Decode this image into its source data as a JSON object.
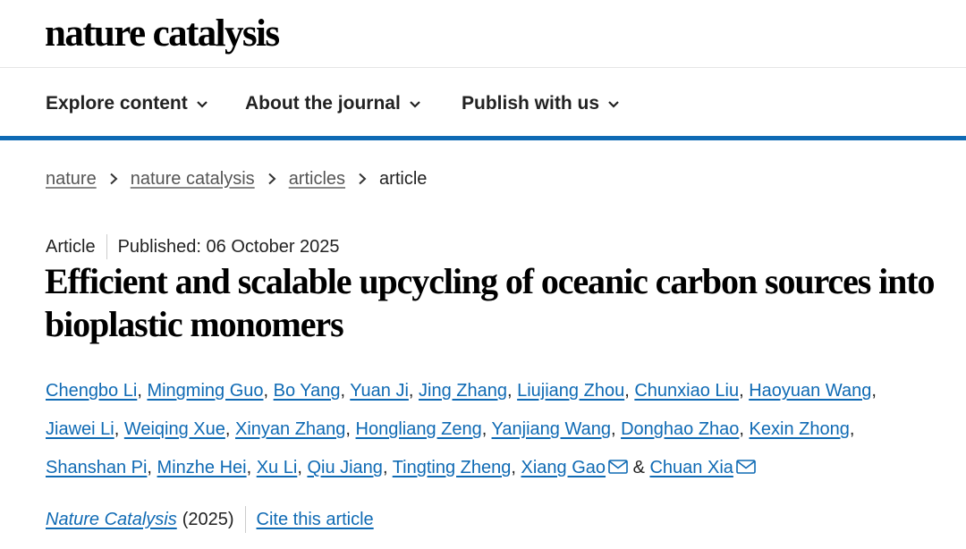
{
  "header": {
    "logo_text": "nature catalysis"
  },
  "nav": {
    "explore_label": "Explore content",
    "about_label": "About the journal",
    "publish_label": "Publish with us"
  },
  "breadcrumb": {
    "items": [
      "nature",
      "nature catalysis",
      "articles"
    ],
    "current": "article"
  },
  "article": {
    "type": "Article",
    "published": "Published: 06 October 2025",
    "title": "Efficient and scalable upcycling of oceanic carbon sources into bioplastic monomers",
    "authors": [
      "Chengbo Li",
      "Mingming Guo",
      "Bo Yang",
      "Yuan Ji",
      "Jing Zhang",
      "Liujiang Zhou",
      "Chunxiao Liu",
      "Haoyuan Wang",
      "Jiawei Li",
      "Weiqing Xue",
      "Xinyan Zhang",
      "Hongliang Zeng",
      "Yanjiang Wang",
      "Donghao Zhao",
      "Kexin Zhong",
      "Shanshan Pi",
      "Minzhe Hei",
      "Xu Li",
      "Qiu Jiang",
      "Tingting Zheng",
      "Xiang Gao",
      "Chuan Xia"
    ],
    "author_separator": ", ",
    "final_separator": " & ",
    "corresponding_icon": "envelope-icon"
  },
  "citation": {
    "journal": "Nature Catalysis",
    "year": "(2025)",
    "cite_label": "Cite this article"
  },
  "colors": {
    "link": "#0f6ab4",
    "rule": "#0f6ab4",
    "text": "#222222"
  }
}
